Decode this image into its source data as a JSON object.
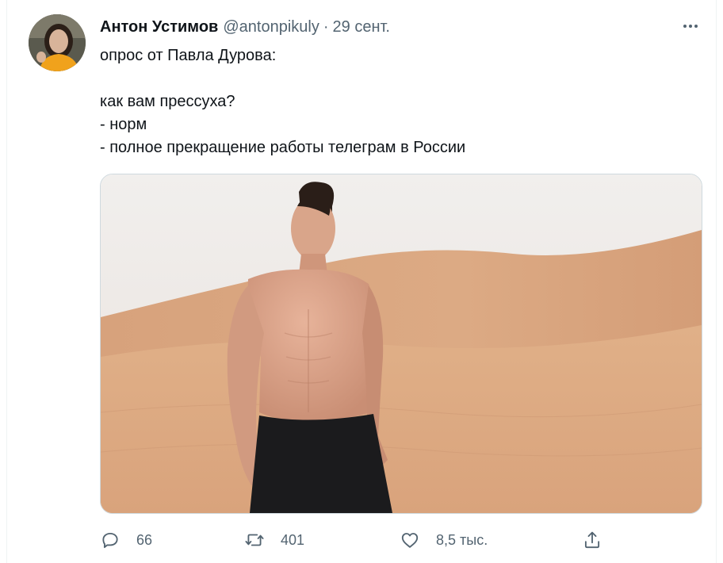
{
  "tweet": {
    "author_name": "Антон Устимов",
    "handle": "@antonpikuly",
    "separator": "·",
    "time": "29 сент.",
    "lines": [
      "опрос от Павла Дурова:",
      "",
      "как вам прессуха?",
      "- норм",
      "- полное прекращение работы телеграм в России"
    ]
  },
  "actions": {
    "reply_count": "66",
    "retweet_count": "401",
    "like_count": "8,5 тыс."
  },
  "icons": {
    "more": "more-dots-icon",
    "reply": "reply-bubble-icon",
    "retweet": "retweet-icon",
    "like": "heart-icon",
    "share": "share-upload-icon"
  },
  "colors": {
    "text_primary": "#0f1419",
    "text_secondary": "#536471",
    "border": "#cfd9de"
  }
}
